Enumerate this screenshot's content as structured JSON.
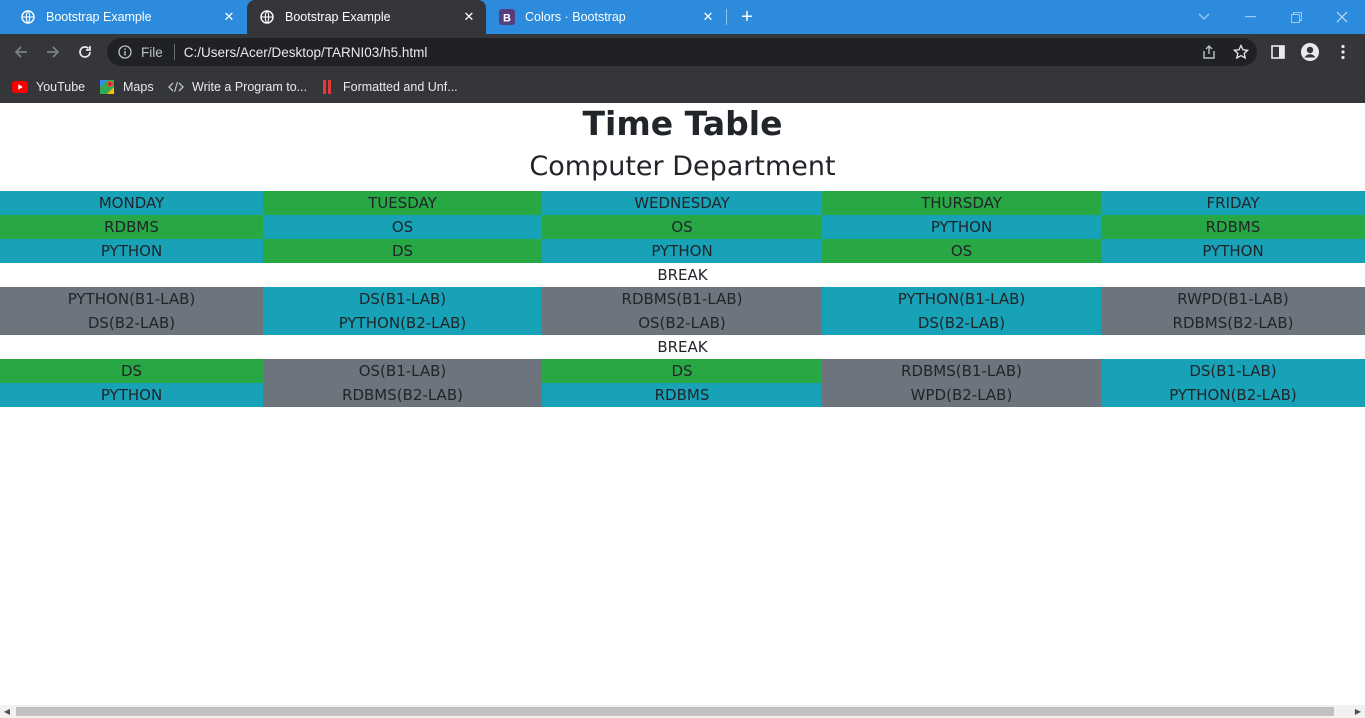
{
  "browser": {
    "tabs": [
      {
        "title": "Bootstrap Example",
        "icon": "globe-icon",
        "active": false
      },
      {
        "title": "Bootstrap Example",
        "icon": "globe-icon",
        "active": true
      },
      {
        "title": "Colors · Bootstrap",
        "icon": "bootstrap-icon",
        "active": false
      }
    ],
    "close_glyph": "✕",
    "new_tab_glyph": "+",
    "address": {
      "scheme_label": "File",
      "url": "C:/Users/Acer/Desktop/TARNI03/h5.html"
    },
    "bookmarks": [
      {
        "label": "YouTube",
        "icon": "youtube-icon"
      },
      {
        "label": "Maps",
        "icon": "maps-icon"
      },
      {
        "label": "Write a Program to...",
        "icon": "code-icon"
      },
      {
        "label": "Formatted and Unf...",
        "icon": "bookmark-bars-icon"
      }
    ],
    "colors": {
      "tabstrip": "#2c8bdc",
      "toolbar": "#35363a",
      "omnibox": "#202124"
    }
  },
  "page": {
    "title": "Time Table",
    "subtitle": "Computer Department",
    "days": [
      "MONDAY",
      "TUESDAY",
      "WEDNESDAY",
      "THURSDAY",
      "FRIDAY"
    ],
    "morning": [
      [
        "RDBMS",
        "OS",
        "OS",
        "PYTHON",
        "RDBMS"
      ],
      [
        "PYTHON",
        "DS",
        "PYTHON",
        "OS",
        "PYTHON"
      ]
    ],
    "break_label": "BREAK",
    "labs": [
      [
        "PYTHON(B1-LAB)",
        "DS(B2-LAB)"
      ],
      [
        "DS(B1-LAB)",
        "PYTHON(B2-LAB)"
      ],
      [
        "RDBMS(B1-LAB)",
        "OS(B2-LAB)"
      ],
      [
        "PYTHON(B1-LAB)",
        "DS(B2-LAB)"
      ],
      [
        "RWPD(B1-LAB)",
        "RDBMS(B2-LAB)"
      ]
    ],
    "break_label_2": "BREAK",
    "afternoon": [
      [
        "DS",
        "OS(B1-LAB)",
        "DS",
        "RDBMS(B1-LAB)",
        "DS(B1-LAB)"
      ],
      [
        "PYTHON",
        "RDBMS(B2-LAB)",
        "RDBMS",
        "WPD(B2-LAB)",
        "PYTHON(B2-LAB)"
      ]
    ],
    "colors": {
      "info": "#17a2b8",
      "success": "#28a745",
      "secondary": "#6c757d",
      "text": "#212529"
    }
  }
}
